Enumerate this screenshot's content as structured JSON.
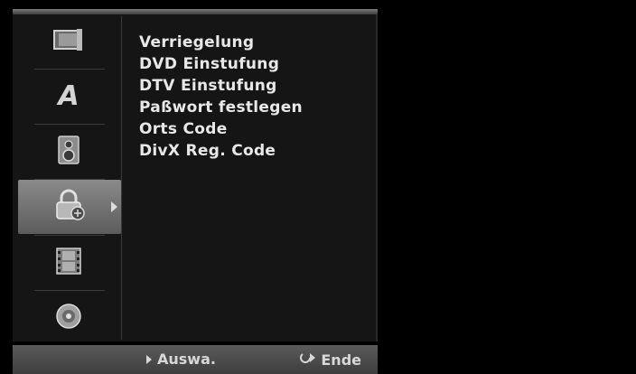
{
  "menu": {
    "icons": [
      {
        "name": "screen-icon",
        "selected": false
      },
      {
        "name": "language-icon",
        "label": "A",
        "selected": false
      },
      {
        "name": "speaker-icon",
        "selected": false
      },
      {
        "name": "lock-icon",
        "selected": true
      },
      {
        "name": "film-icon",
        "selected": false
      },
      {
        "name": "disc-icon",
        "selected": false
      }
    ],
    "items": [
      "Verriegelung",
      "DVD Einstufung",
      "DTV Einstufung",
      "Paßwort festlegen",
      "Orts Code",
      "DivX Reg. Code"
    ]
  },
  "footer": {
    "select_label": "Auswa.",
    "exit_label": "Ende",
    "select_icon": "play-triangle-icon",
    "exit_icon": "return-icon"
  },
  "colors": {
    "panel": "#151515",
    "selected_tab": "#7a7a7a",
    "text": "#e8e8e8"
  }
}
